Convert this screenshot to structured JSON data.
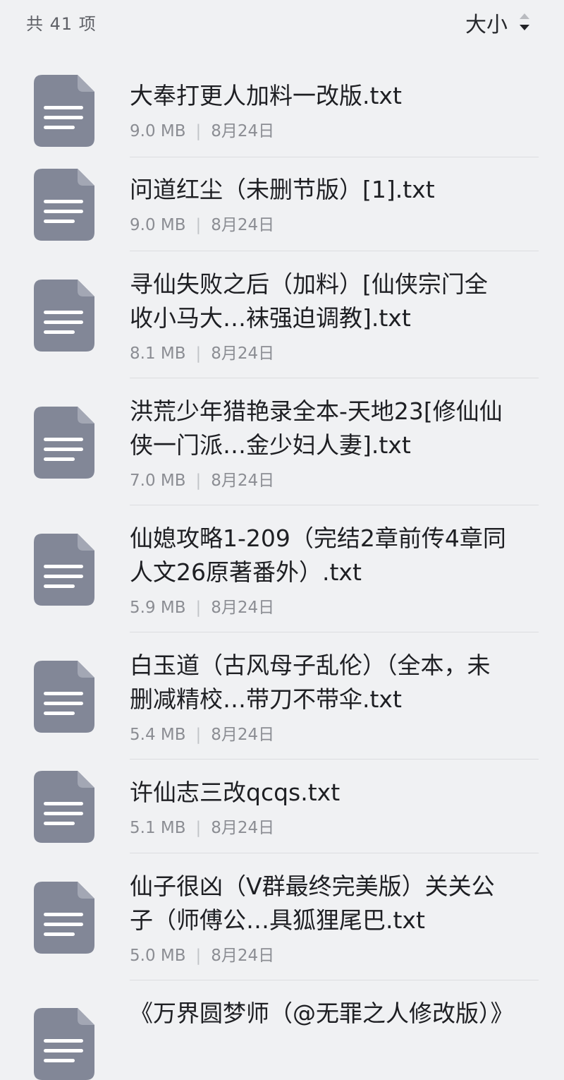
{
  "header": {
    "count_label": "共 41 项",
    "sort_label": "大小"
  },
  "files": [
    {
      "name": "大奉打更人加料一改版.txt",
      "size": "9.0 MB",
      "date": "8月24日",
      "icon": "document-icon"
    },
    {
      "name": "问道红尘（未删节版）[1].txt",
      "size": "9.0 MB",
      "date": "8月24日",
      "icon": "document-icon"
    },
    {
      "name": "寻仙失败之后（加料）[仙侠宗门全收小马大…袜强迫调教].txt",
      "size": "8.1 MB",
      "date": "8月24日",
      "icon": "document-icon"
    },
    {
      "name": "洪荒少年猎艳录全本-天地23[修仙仙侠一门派…金少妇人妻].txt",
      "size": "7.0 MB",
      "date": "8月24日",
      "icon": "document-icon"
    },
    {
      "name": "仙媳攻略1-209（完结2章前传4章同人文26原著番外）.txt",
      "size": "5.9 MB",
      "date": "8月24日",
      "icon": "document-icon"
    },
    {
      "name": "白玉道（古风母子乱伦）（全本，未删减精校…带刀不带伞.txt",
      "size": "5.4 MB",
      "date": "8月24日",
      "icon": "document-icon"
    },
    {
      "name": "许仙志三改qcqs.txt",
      "size": "5.1 MB",
      "date": "8月24日",
      "icon": "document-icon"
    },
    {
      "name": "仙子很凶（V群最终完美版）关关公子（师傅公…具狐狸尾巴.txt",
      "size": "5.0 MB",
      "date": "8月24日",
      "icon": "document-icon"
    },
    {
      "name": "《万界圆梦师（@无罪之人修改版）》",
      "size": "",
      "date": "",
      "icon": "document-icon"
    }
  ],
  "colors": {
    "background": "#f0f1f3",
    "icon_fill": "#828797",
    "icon_lines": "#ffffff",
    "text_primary": "#1e1f23",
    "text_secondary": "#8b8d93"
  }
}
